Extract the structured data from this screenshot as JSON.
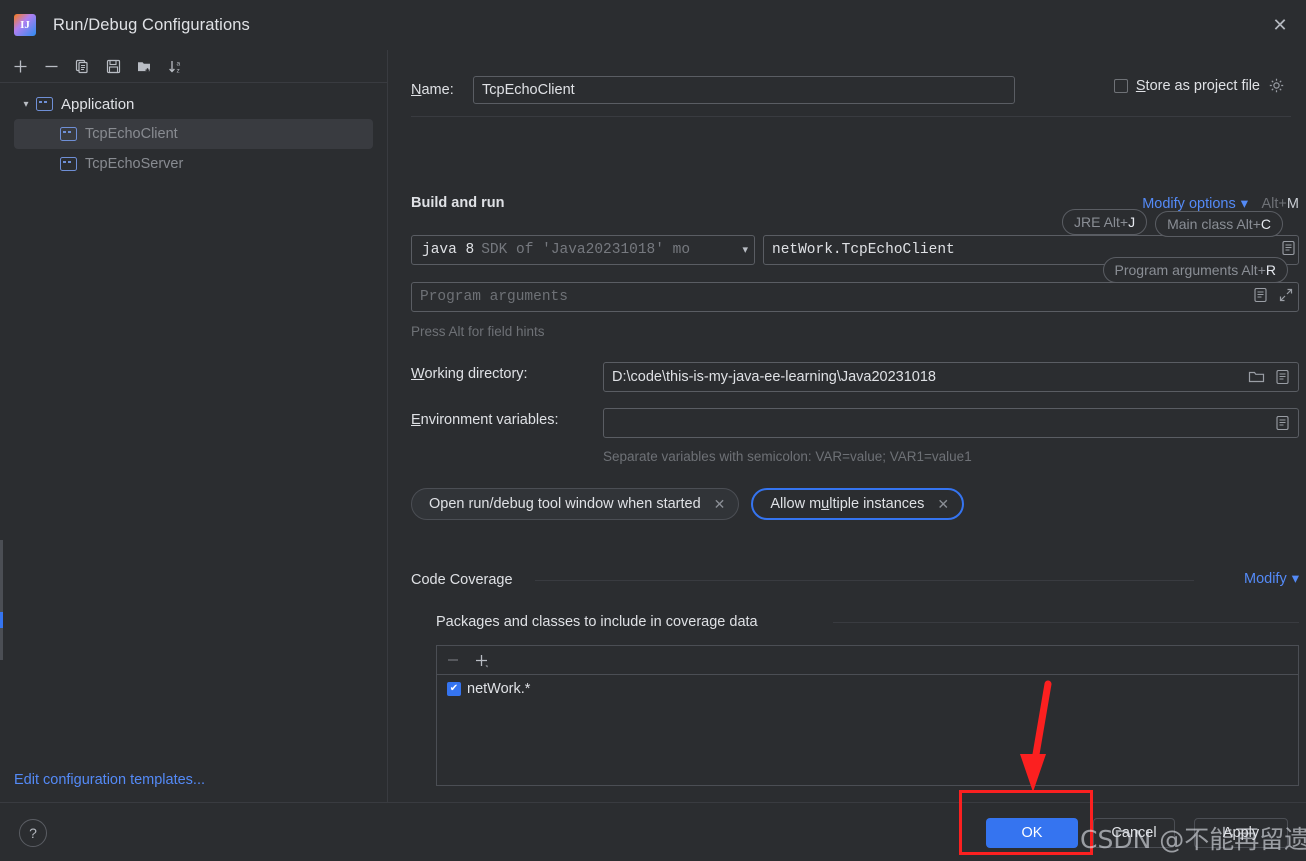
{
  "window": {
    "title": "Run/Debug Configurations",
    "app_icon": "intellij-idea-icon",
    "close_icon": "close-icon"
  },
  "sidebar": {
    "toolbar": [
      {
        "name": "add-configuration-button",
        "icon": "plus-icon",
        "glyph": "+"
      },
      {
        "name": "remove-configuration-button",
        "icon": "minus-icon",
        "glyph": "−"
      },
      {
        "name": "copy-configuration-button",
        "icon": "copy-icon",
        "glyph": "copy"
      },
      {
        "name": "save-configuration-button",
        "icon": "save-icon",
        "glyph": "save"
      },
      {
        "name": "new-folder-button",
        "icon": "folder-add-icon",
        "glyph": "folder"
      },
      {
        "name": "sort-configurations-button",
        "icon": "sort-alphabetical-icon",
        "glyph": "sort"
      }
    ],
    "group": {
      "label": "Application",
      "expanded": true,
      "icon": "application-config-icon"
    },
    "items": [
      {
        "label": "TcpEchoClient",
        "selected": true,
        "icon": "run-config-icon"
      },
      {
        "label": "TcpEchoServer",
        "selected": false,
        "icon": "run-config-icon"
      }
    ],
    "edit_templates_link": "Edit configuration templates..."
  },
  "form": {
    "name_label": "Name:",
    "name_label_mnemonic": "N",
    "name_value": "TcpEchoClient",
    "store_as_project_file": {
      "label": "Store as project file",
      "mnemonic": "S",
      "checked": false,
      "gear_icon": "gear-icon"
    },
    "build_and_run": {
      "section_title": "Build and run",
      "modify_options_link": "Modify options",
      "modify_options_shortcut_prefix": "Alt+",
      "modify_options_shortcut_key": "M",
      "sdk_value_bold": "java 8",
      "sdk_value_dim": "SDK of 'Java20231018' mo",
      "main_class_value": "netWork.TcpEchoClient",
      "program_arguments_placeholder": "Program arguments",
      "alt_hint": "Press Alt for field hints",
      "badges": [
        {
          "name": "jre-shortcut-badge",
          "text": "JRE Alt+",
          "key": "J"
        },
        {
          "name": "main-class-shortcut-badge",
          "text": "Main class Alt+",
          "key": "C"
        },
        {
          "name": "program-arguments-shortcut-badge",
          "text": "Program arguments Alt+",
          "key": "R"
        }
      ]
    },
    "working_directory": {
      "label": "Working directory:",
      "mnemonic": "W",
      "value": "D:\\code\\this-is-my-java-ee-learning\\Java20231018",
      "browse_icon": "folder-open-icon",
      "macro_icon": "insert-macro-icon"
    },
    "environment_variables": {
      "label": "Environment variables:",
      "mnemonic": "E",
      "value": "",
      "macro_icon": "insert-macro-icon",
      "hint": "Separate variables with semicolon: VAR=value; VAR1=value1"
    },
    "option_chips": [
      {
        "label": "Open run/debug tool window when started",
        "focused": false,
        "close_icon": "chip-close-icon"
      },
      {
        "label": "Allow multiple instances",
        "focused": true,
        "close_icon": "chip-close-icon",
        "mnemonic": "u"
      }
    ],
    "code_coverage": {
      "section_title": "Code Coverage",
      "modify_link": "Modify",
      "subsection_title": "Packages and classes to include in coverage data",
      "toolbar": [
        {
          "name": "remove-package-button",
          "icon": "minus-icon",
          "glyph": "−"
        },
        {
          "name": "add-package-button",
          "icon": "plus-icon",
          "glyph": "+"
        }
      ],
      "entries": [
        {
          "label": "netWork.*",
          "checked": true
        }
      ]
    }
  },
  "footer": {
    "help_icon": "help-icon",
    "help_label": "?",
    "ok_label": "OK",
    "cancel_label": "Cancel",
    "apply_label": "Apply"
  },
  "annotations": {
    "highlight_color": "#fb2020",
    "arrow_icon": "red-arrow-down-icon",
    "watermark": "CSDN @不能再留遗憾了"
  },
  "colors": {
    "background": "#2b2d30",
    "accent_blue": "#3574f0",
    "link_blue": "#548af7",
    "border": "#5a5d63",
    "text": "#dfe1e5",
    "text_dim": "#6e7176"
  }
}
